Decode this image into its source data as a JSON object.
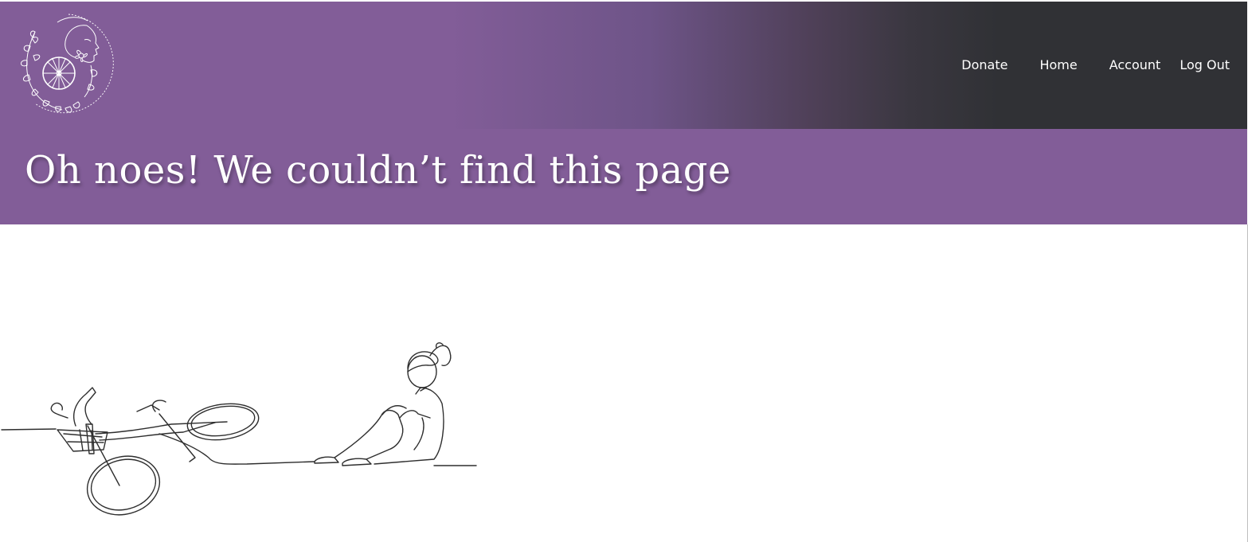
{
  "header": {
    "logo_name": "cyclist-woman-logo",
    "nav": {
      "donate": "Donate",
      "home": "Home",
      "account": "Account",
      "logout": "Log Out"
    }
  },
  "main": {
    "title": "Oh noes! We couldn’t find this page",
    "illustration_name": "fallen-bike-girl-illustration"
  },
  "colors": {
    "brand_purple": "#825d98",
    "header_dark": "#303135",
    "text_light": "#ffffff"
  }
}
